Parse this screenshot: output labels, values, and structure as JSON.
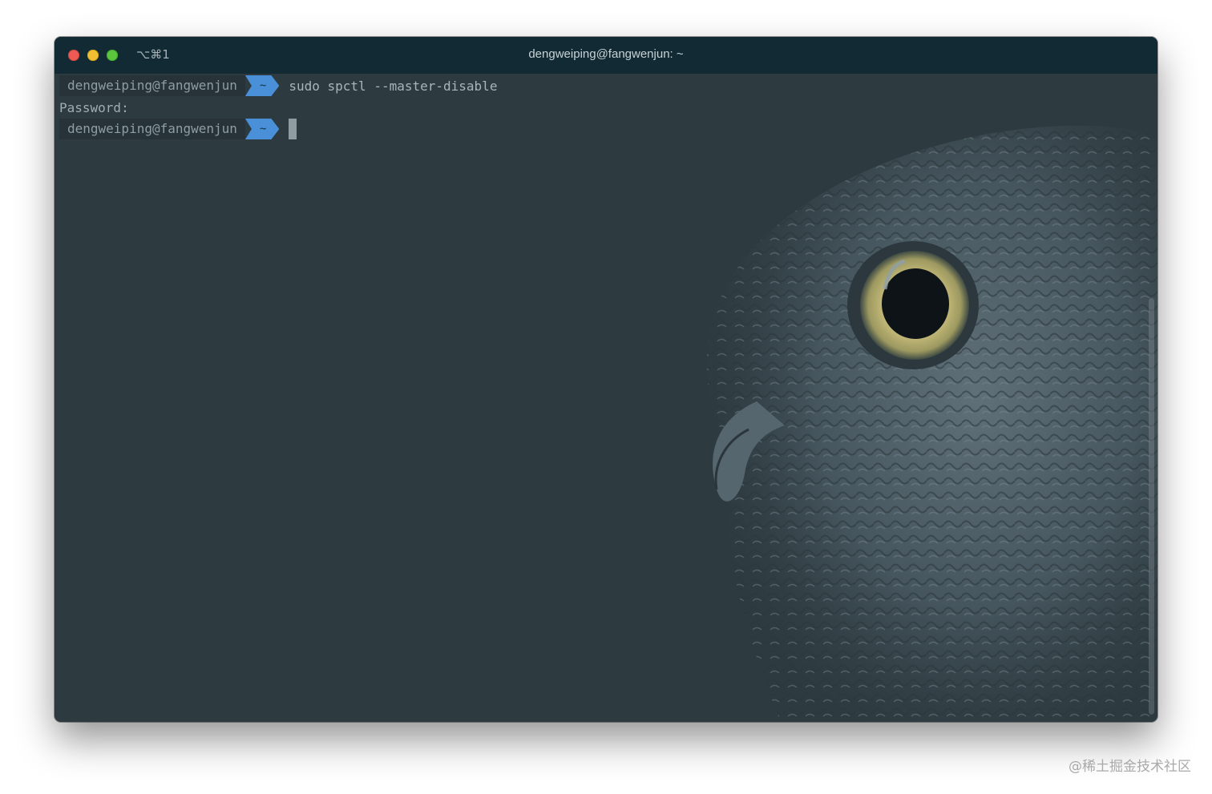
{
  "window": {
    "shortcut": "⌥⌘1",
    "title": "dengweiping@fangwenjun: ~"
  },
  "terminal": {
    "lines": [
      {
        "user": "dengweiping@fangwenjun",
        "dir": "~",
        "command": "sudo spctl --master-disable"
      },
      {
        "text": "Password:"
      },
      {
        "user": "dengweiping@fangwenjun",
        "dir": "~",
        "command": ""
      }
    ]
  },
  "background": {
    "image": "owl-photo"
  },
  "colors": {
    "titlebar": "#122a34",
    "terminal_bg": "#2d3a40",
    "prompt_dir_bg": "#4a90d9"
  },
  "watermark": "@稀土掘金技术社区"
}
